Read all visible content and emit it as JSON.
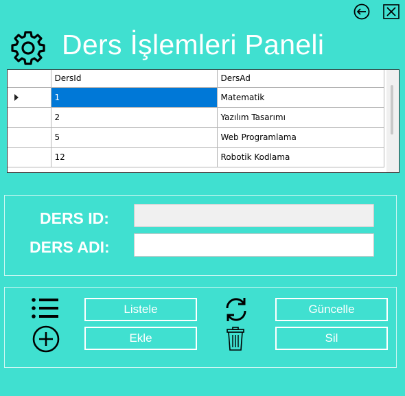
{
  "header": {
    "title": "Ders İşlemleri Paneli",
    "icon": "gear-icon"
  },
  "window_controls": {
    "back_icon": "back-arrow-icon",
    "close_icon": "close-icon"
  },
  "grid": {
    "columns": [
      "DersId",
      "DersAd"
    ],
    "rows": [
      {
        "id": "1",
        "name": "Matematik",
        "selected": true
      },
      {
        "id": "2",
        "name": "Yazılım Tasarımı",
        "selected": false
      },
      {
        "id": "5",
        "name": "Web Programlama",
        "selected": false
      },
      {
        "id": "12",
        "name": "Robotik Kodlama",
        "selected": false
      }
    ],
    "selection_color": "#0078D7"
  },
  "form": {
    "id_label": "DERS ID:",
    "id_value": "",
    "name_label": "DERS ADI:",
    "name_value": ""
  },
  "actions": {
    "list_label": "Listele",
    "add_label": "Ekle",
    "update_label": "Güncelle",
    "delete_label": "Sil",
    "icons": [
      "list-icon",
      "add-circle-icon",
      "refresh-icon",
      "trash-icon"
    ]
  },
  "colors": {
    "background": "#40E0D0",
    "text": "#FFFFFF"
  }
}
